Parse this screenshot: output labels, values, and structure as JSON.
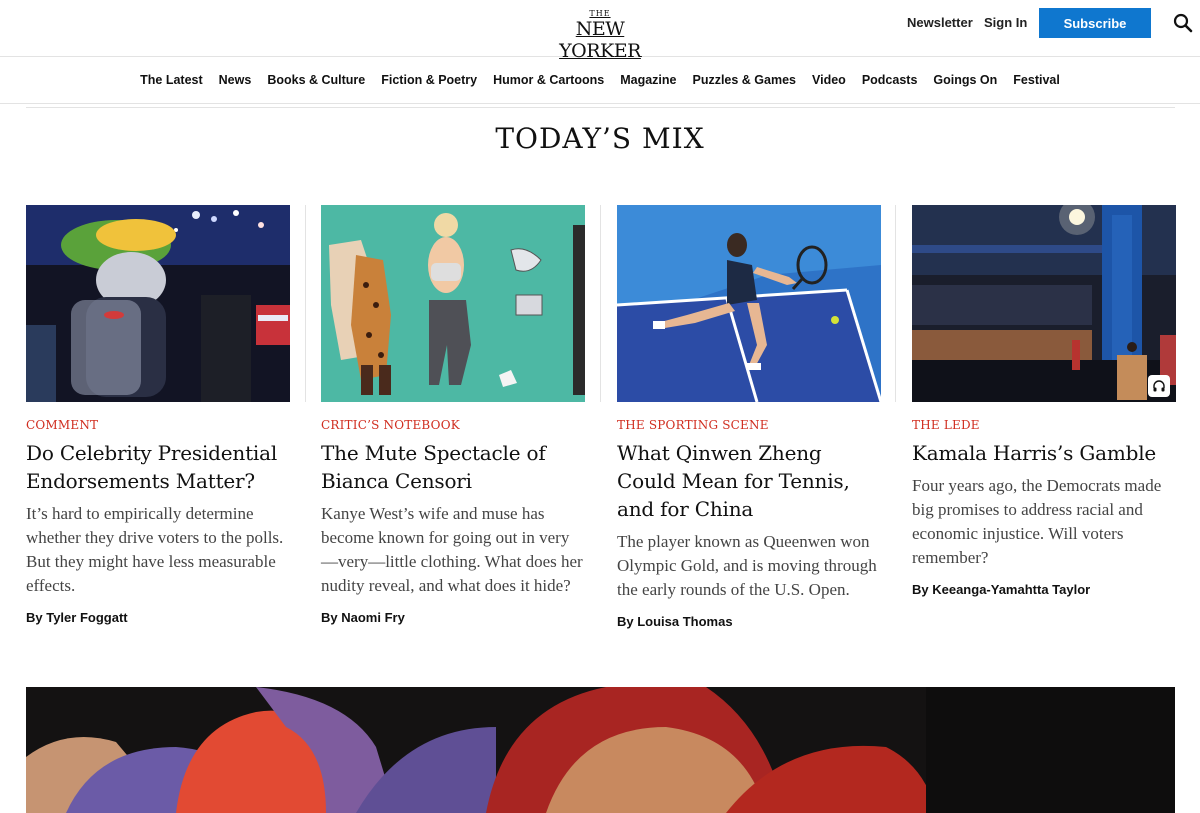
{
  "header": {
    "logo_the": "THE",
    "logo_name": "NEW YORKER",
    "newsletter": "Newsletter",
    "sign_in": "Sign In",
    "subscribe": "Subscribe"
  },
  "nav": {
    "items": [
      "The Latest",
      "News",
      "Books & Culture",
      "Fiction & Poetry",
      "Humor & Cartoons",
      "Magazine",
      "Puzzles & Games",
      "Video",
      "Podcasts",
      "Goings On",
      "Festival"
    ]
  },
  "section": {
    "title": "TODAY’S MIX"
  },
  "cards": [
    {
      "rubric": "Comment",
      "headline": "Do Celebrity Presidential Endorsements Matter?",
      "dek": "It’s hard to empirically determine whether they drive voters to the polls. But they might have less measurable effects.",
      "byline": "By Tyler Foggatt"
    },
    {
      "rubric": "Critic’s Notebook",
      "headline": "The Mute Spectacle of Bianca Censori",
      "dek": "Kanye West’s wife and muse has become known for going out in very—very—little clothing. What does her nudity reveal, and what does it hide?",
      "byline": "By Naomi Fry"
    },
    {
      "rubric": "The Sporting Scene",
      "headline": "What Qinwen Zheng Could Mean for Tennis, and for China",
      "dek": "The player known as Queenwen won Olympic Gold, and is moving through the early rounds of the U.S. Open.",
      "byline": "By Louisa Thomas"
    },
    {
      "rubric": "The Lede",
      "headline": "Kamala Harris’s Gamble",
      "dek": "Four years ago, the Democrats made big promises to address racial and economic injustice. Will voters remember?",
      "byline": "By Keeanga-Yamahtta Taylor"
    }
  ],
  "colors": {
    "accent_blue": "#0f77cf",
    "rubric_red": "#d02d1f"
  }
}
